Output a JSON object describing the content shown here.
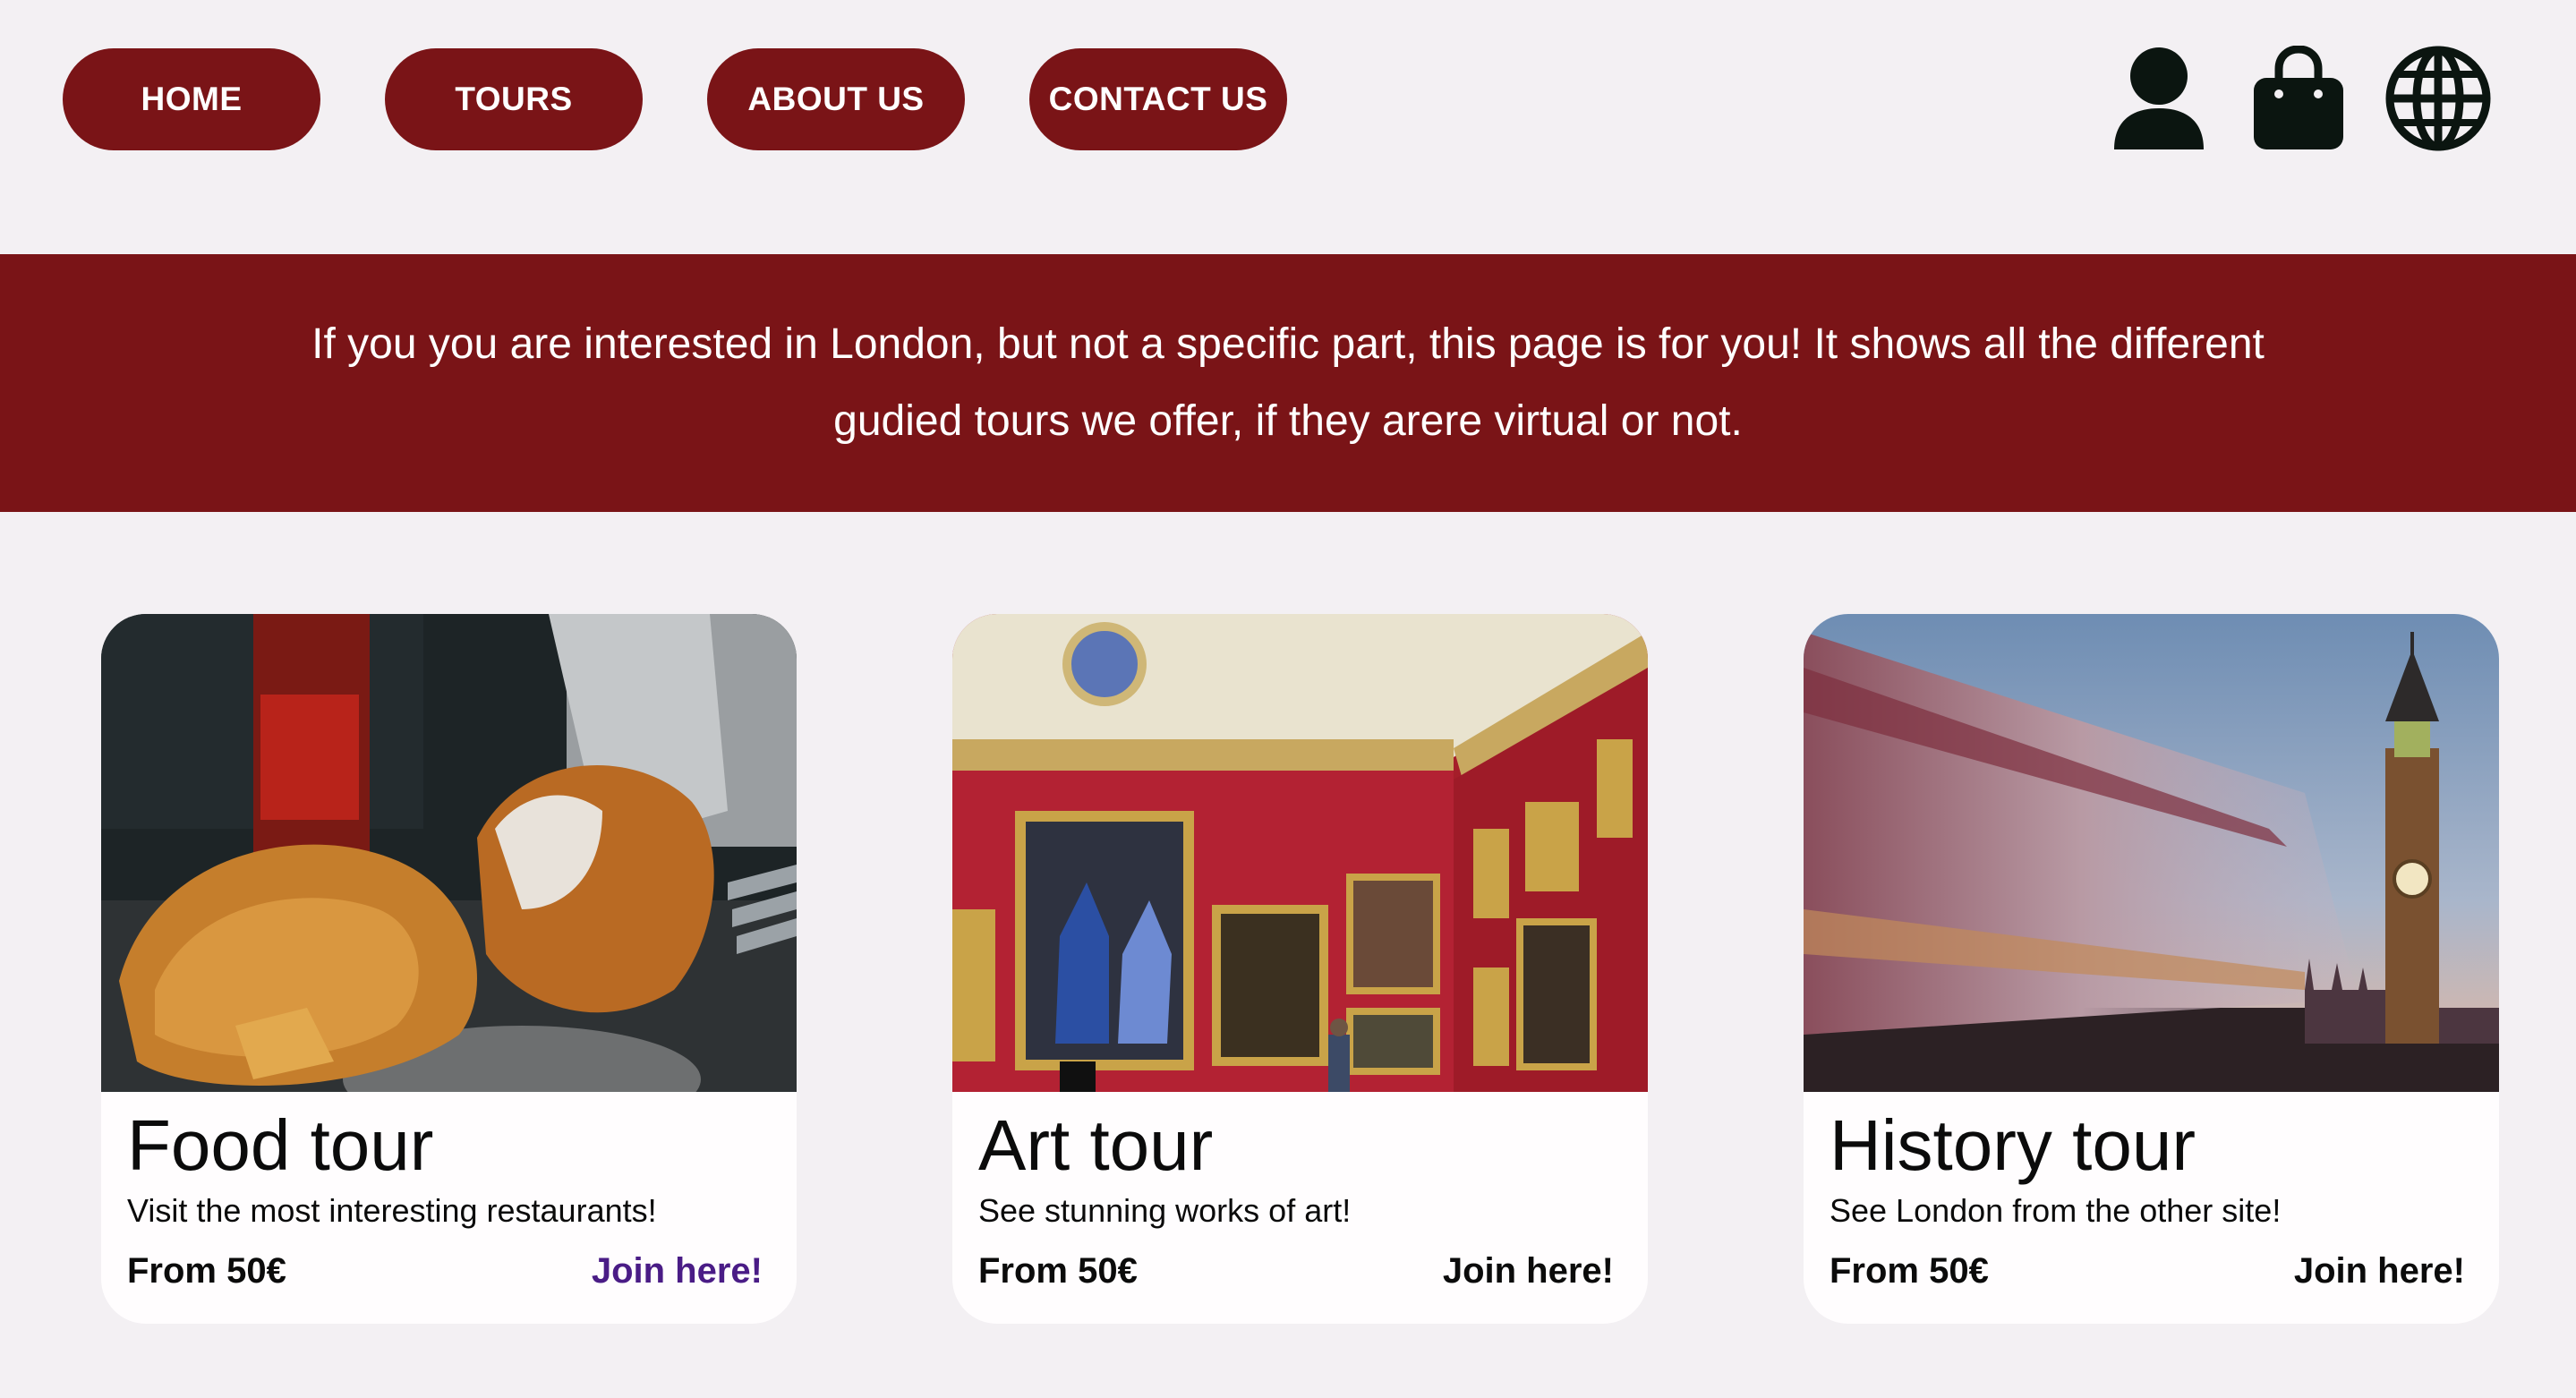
{
  "nav": {
    "items": [
      {
        "label": "HOME"
      },
      {
        "label": "TOURS"
      },
      {
        "label": "ABOUT US"
      },
      {
        "label": "CONTACT US"
      }
    ],
    "icons": [
      "user-icon",
      "shopping-bag-icon",
      "globe-icon"
    ]
  },
  "banner": {
    "text": "If you you are interested in London, but not a specific part, this page is for you! It shows all the different gudied tours we offer, if they arere virtual or not."
  },
  "cards": [
    {
      "title": "Food tour",
      "description": "Visit the most interesting restaurants!",
      "price": "From 50€",
      "cta": "Join here!",
      "image": "fish-and-chips-photo"
    },
    {
      "title": "Art tour",
      "description": "See stunning works of art!",
      "price": "From 50€",
      "cta": "Join here!",
      "image": "art-gallery-photo"
    },
    {
      "title": "History tour",
      "description": "See London from the other site!",
      "price": "From 50€",
      "cta": "Join here!",
      "image": "big-ben-bus-photo"
    }
  ],
  "colors": {
    "brand": "#7a1417",
    "background": "#f3f0f3",
    "card": "#fffdfe",
    "visited_link": "#4a1c86",
    "icon": "#0b1510"
  }
}
